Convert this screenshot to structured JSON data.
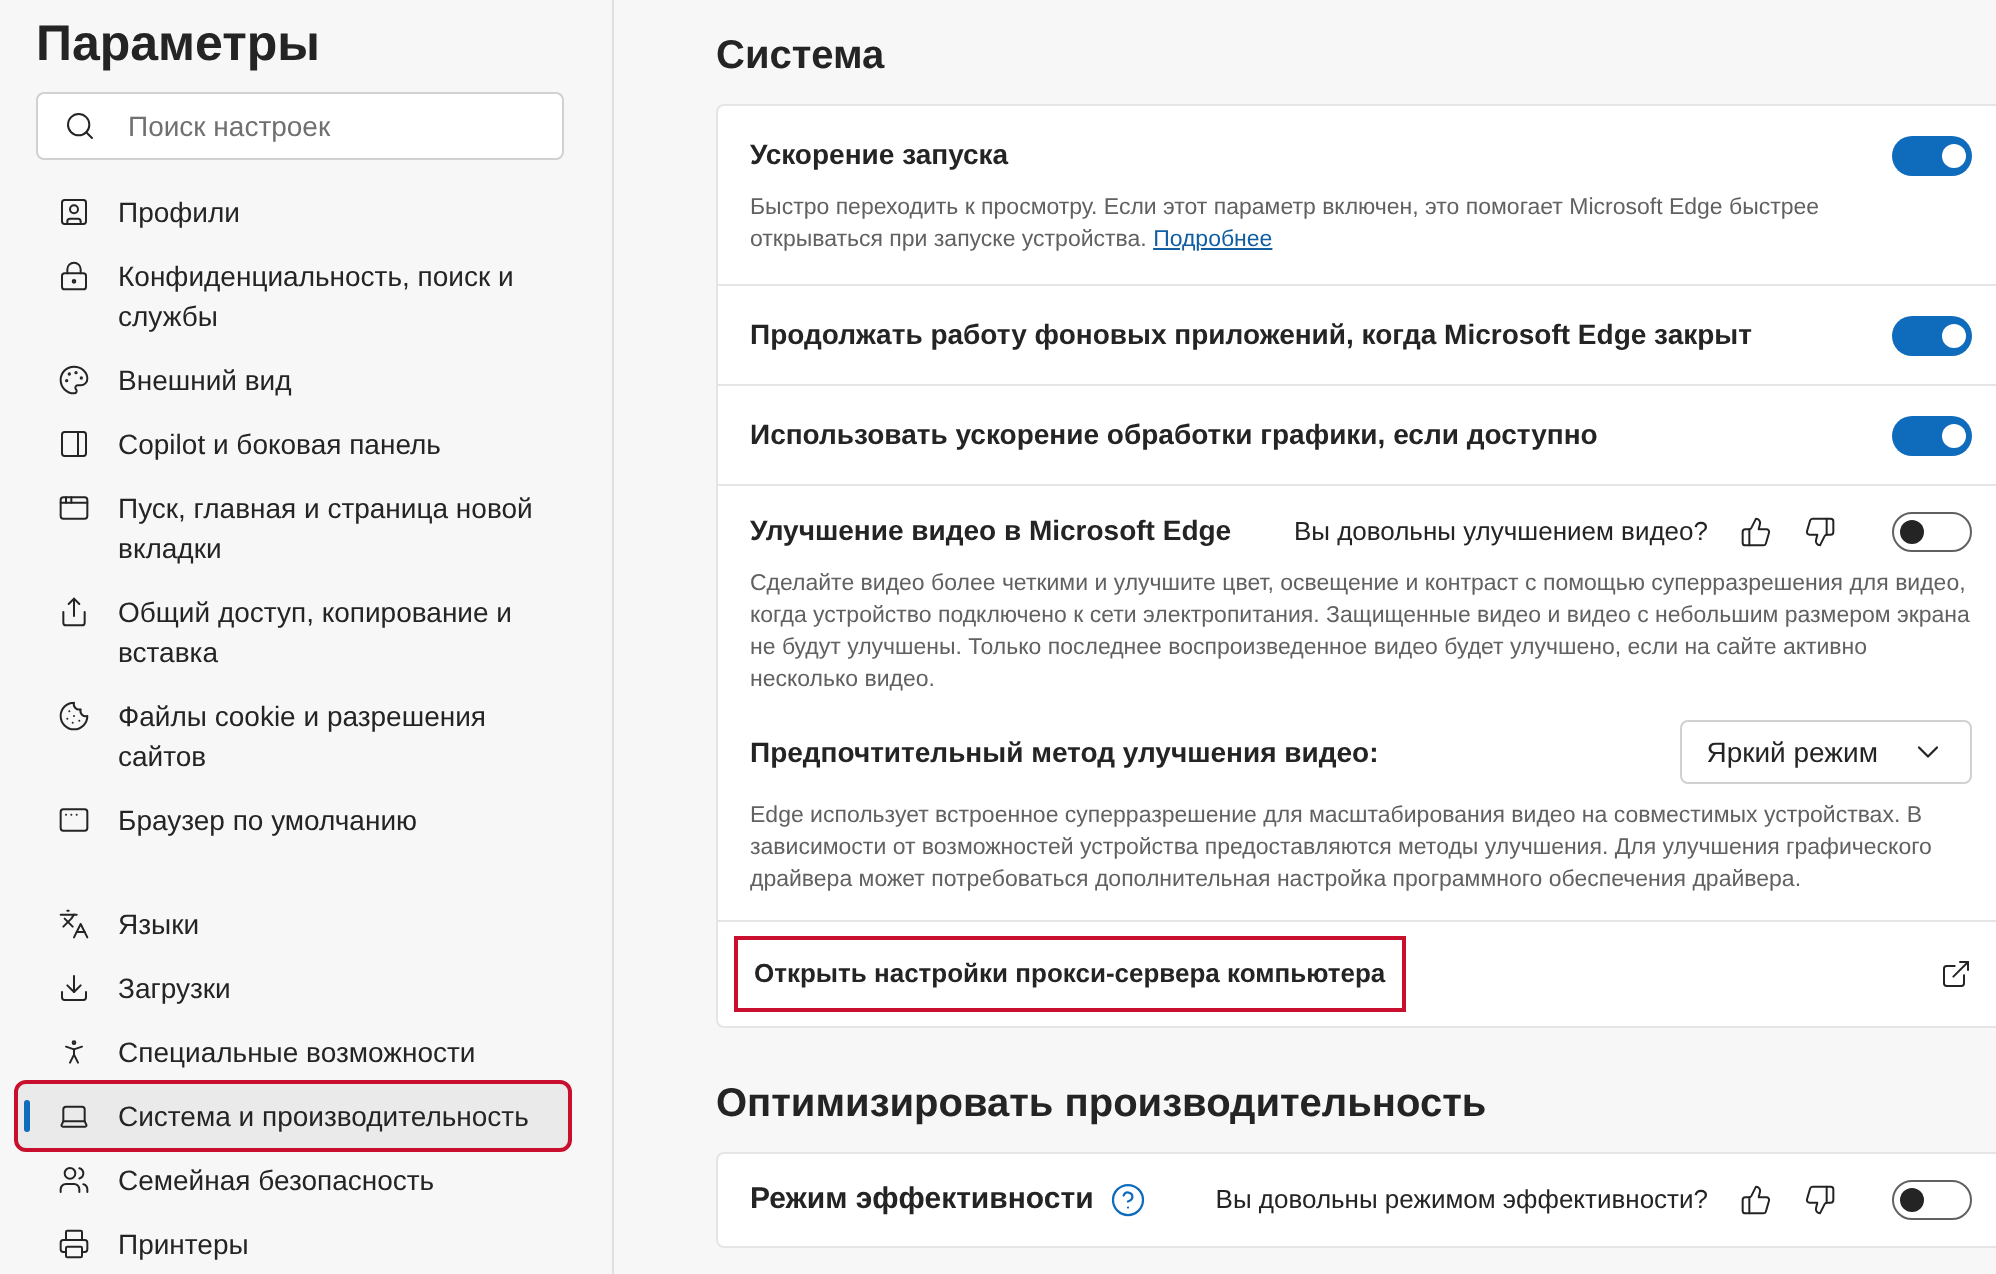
{
  "sidebar": {
    "title": "Параметры",
    "search": {
      "placeholder": "Поиск настроек"
    },
    "groups": [
      [
        {
          "label": "Профили",
          "selected": false,
          "annotated": false
        },
        {
          "label": "Конфиденциальность, поиск и службы",
          "selected": false,
          "annotated": false
        },
        {
          "label": "Внешний вид",
          "selected": false,
          "annotated": false
        },
        {
          "label": "Copilot и боковая панель",
          "selected": false,
          "annotated": false
        },
        {
          "label": "Пуск, главная и страница новой вкладки",
          "selected": false,
          "annotated": false
        },
        {
          "label": "Общий доступ, копирование и вставка",
          "selected": false,
          "annotated": false
        },
        {
          "label": "Файлы cookie и разрешения сайтов",
          "selected": false,
          "annotated": false
        },
        {
          "label": "Браузер по умолчанию",
          "selected": false,
          "annotated": false
        }
      ],
      [
        {
          "label": "Языки",
          "selected": false,
          "annotated": false
        },
        {
          "label": "Загрузки",
          "selected": false,
          "annotated": false
        },
        {
          "label": "Специальные возможности",
          "selected": false,
          "annotated": false
        },
        {
          "label": "Система и производительность",
          "selected": true,
          "annotated": true
        },
        {
          "label": "Семейная безопасность",
          "selected": false,
          "annotated": false
        },
        {
          "label": "Принтеры",
          "selected": false,
          "annotated": false
        }
      ]
    ]
  },
  "sections": [
    {
      "title": "Система",
      "rows": [
        {
          "kind": "toggle",
          "title": "Ускорение запуска",
          "on": true,
          "description": "Быстро переходить к просмотру. Если этот параметр включен, это помогает Microsoft Edge быстрее открываться при запуске устройства.",
          "link": "Подробнее"
        },
        {
          "kind": "toggle",
          "title": "Продолжать работу фоновых приложений, когда Microsoft Edge закрыт",
          "on": true
        },
        {
          "kind": "toggle",
          "title": "Использовать ускорение обработки графики, если доступно",
          "on": true
        },
        {
          "kind": "feedback",
          "title": "Улучшение видео в Microsoft Edge",
          "question": "Вы довольны улучшением видео?",
          "on": false,
          "description": "Сделайте видео более четкими и улучшите цвет, освещение и контраст с помощью суперразрешения для видео, когда устройство подключено к сети электропитания. Защищенные видео и видео с небольшим размером экрана не будут улучшены. Только последнее воспроизведенное видео будет улучшено, если на сайте активно несколько видео.",
          "sub": {
            "title": "Предпочтительный метод улучшения видео:",
            "value": "Яркий режим",
            "description": "Edge использует встроенное суперразрешение для масштабирования видео на совместимых устройствах. В зависимости от возможностей устройства предоставляются методы улучшения. Для улучшения графического драйвера может потребоваться дополнительная настройка программного обеспечения драйвера."
          }
        },
        {
          "kind": "external",
          "title": "Открыть настройки прокси-сервера компьютера",
          "annotated": true
        }
      ]
    },
    {
      "title": "Оптимизировать производительность",
      "rows": [
        {
          "kind": "feedback",
          "title": "Режим эффективности",
          "help": true,
          "question": "Вы довольны режимом эффективности?",
          "on": false
        }
      ]
    }
  ]
}
